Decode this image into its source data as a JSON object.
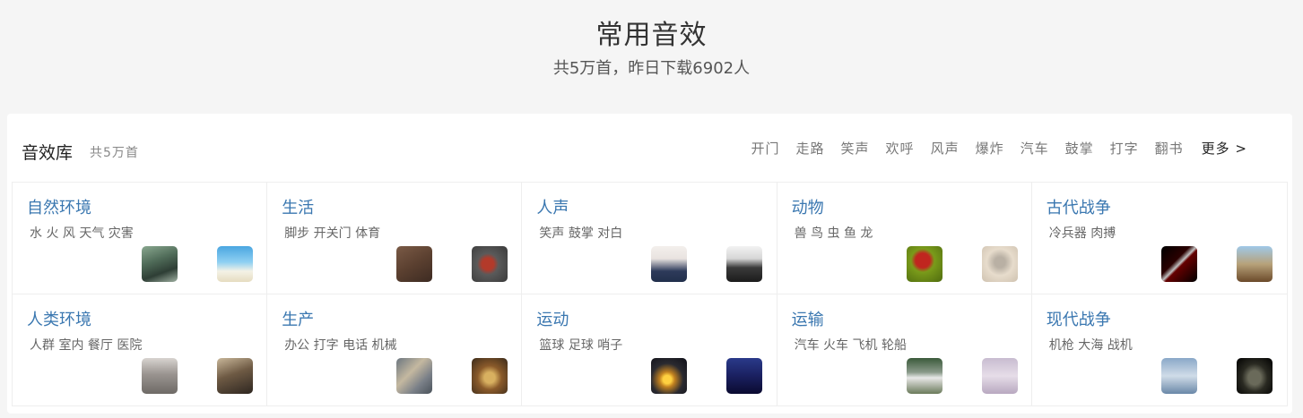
{
  "hero": {
    "title": "常用音效",
    "subtitle": "共5万首，昨日下载6902人"
  },
  "panel": {
    "title": "音效库",
    "count": "共5万首",
    "tags": [
      "开门",
      "走路",
      "笑声",
      "欢呼",
      "风声",
      "爆炸",
      "汽车",
      "鼓掌",
      "打字",
      "翻书"
    ],
    "more": "更多 >"
  },
  "categories": [
    {
      "title": "自然环境",
      "tags": "水 火 风 天气 灾害",
      "thumbs": [
        "forest-image",
        "beach-image"
      ]
    },
    {
      "title": "生活",
      "tags": "脚步 开关门 体育",
      "thumbs": [
        "footsteps-image",
        "motorcycle-image"
      ]
    },
    {
      "title": "人声",
      "tags": "笑声 鼓掌 对白",
      "thumbs": [
        "woman-portrait-image",
        "crowd-cheering-image"
      ]
    },
    {
      "title": "动物",
      "tags": "兽 鸟 虫 鱼 龙",
      "thumbs": [
        "ladybug-image",
        "hummingbird-image"
      ]
    },
    {
      "title": "古代战争",
      "tags": "冷兵器 肉搏",
      "thumbs": [
        "sword-image",
        "horse-rider-image"
      ]
    },
    {
      "title": "人类环境",
      "tags": "人群 室内 餐厅 医院",
      "thumbs": [
        "indoor-hall-image",
        "mall-image"
      ]
    },
    {
      "title": "生产",
      "tags": "办公 打字 电话 机械",
      "thumbs": [
        "map-desk-image",
        "food-image"
      ]
    },
    {
      "title": "运动",
      "tags": "篮球 足球 哨子",
      "thumbs": [
        "cyclist-sunset-image",
        "players-image"
      ]
    },
    {
      "title": "运输",
      "tags": "汽车 火车 飞机 轮船",
      "thumbs": [
        "train-image",
        "airplane-image"
      ]
    },
    {
      "title": "现代战争",
      "tags": "机枪 大海 战机",
      "thumbs": [
        "drone-image",
        "tank-image"
      ]
    }
  ]
}
